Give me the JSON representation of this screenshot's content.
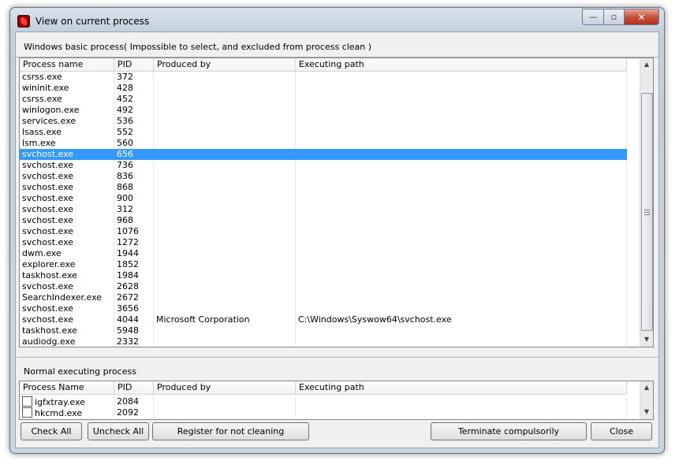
{
  "window": {
    "title": "View on current process",
    "min_glyph": "—",
    "max_glyph": "▫",
    "close_glyph": "✕"
  },
  "basic": {
    "title": "Windows basic process( Impossible to select, and excluded from process clean )",
    "columns": [
      "Process name",
      "PID",
      "Produced by",
      "Executing path"
    ],
    "selected_index": 7,
    "rows": [
      {
        "name": "csrss.exe",
        "pid": "372",
        "by": "",
        "path": ""
      },
      {
        "name": "wininit.exe",
        "pid": "428",
        "by": "",
        "path": ""
      },
      {
        "name": "csrss.exe",
        "pid": "452",
        "by": "",
        "path": ""
      },
      {
        "name": "winlogon.exe",
        "pid": "492",
        "by": "",
        "path": ""
      },
      {
        "name": "services.exe",
        "pid": "536",
        "by": "",
        "path": ""
      },
      {
        "name": "lsass.exe",
        "pid": "552",
        "by": "",
        "path": ""
      },
      {
        "name": "lsm.exe",
        "pid": "560",
        "by": "",
        "path": ""
      },
      {
        "name": "svchost.exe",
        "pid": "656",
        "by": "",
        "path": ""
      },
      {
        "name": "svchost.exe",
        "pid": "736",
        "by": "",
        "path": ""
      },
      {
        "name": "svchost.exe",
        "pid": "836",
        "by": "",
        "path": ""
      },
      {
        "name": "svchost.exe",
        "pid": "868",
        "by": "",
        "path": ""
      },
      {
        "name": "svchost.exe",
        "pid": "900",
        "by": "",
        "path": ""
      },
      {
        "name": "svchost.exe",
        "pid": "312",
        "by": "",
        "path": ""
      },
      {
        "name": "svchost.exe",
        "pid": "968",
        "by": "",
        "path": ""
      },
      {
        "name": "svchost.exe",
        "pid": "1076",
        "by": "",
        "path": ""
      },
      {
        "name": "svchost.exe",
        "pid": "1272",
        "by": "",
        "path": ""
      },
      {
        "name": "dwm.exe",
        "pid": "1944",
        "by": "",
        "path": ""
      },
      {
        "name": "explorer.exe",
        "pid": "1852",
        "by": "",
        "path": ""
      },
      {
        "name": "taskhost.exe",
        "pid": "1984",
        "by": "",
        "path": ""
      },
      {
        "name": "svchost.exe",
        "pid": "2628",
        "by": "",
        "path": ""
      },
      {
        "name": "SearchIndexer.exe",
        "pid": "2672",
        "by": "",
        "path": ""
      },
      {
        "name": "svchost.exe",
        "pid": "3656",
        "by": "",
        "path": ""
      },
      {
        "name": "svchost.exe",
        "pid": "4044",
        "by": "Microsoft Corporation",
        "path": "C:\\Windows\\Syswow64\\svchost.exe"
      },
      {
        "name": "taskhost.exe",
        "pid": "5948",
        "by": "",
        "path": ""
      },
      {
        "name": "audiodg.exe",
        "pid": "2332",
        "by": "",
        "path": ""
      }
    ]
  },
  "normal": {
    "title": "Normal executing process",
    "columns": [
      "Process Name",
      "PID",
      "Produced by",
      "Executing path"
    ],
    "rows": [
      {
        "name": "igfxtray.exe",
        "pid": "2084",
        "by": "",
        "path": "",
        "checked": false
      },
      {
        "name": "hkcmd.exe",
        "pid": "2092",
        "by": "",
        "path": "",
        "checked": false
      }
    ]
  },
  "buttons": {
    "check_all": "Check All",
    "uncheck_all": "Uncheck All",
    "register": "Register for not cleaning",
    "terminate": "Terminate compulsorily",
    "close": "Close"
  },
  "scroll_arrows": {
    "up": "▲",
    "down": "▼"
  }
}
